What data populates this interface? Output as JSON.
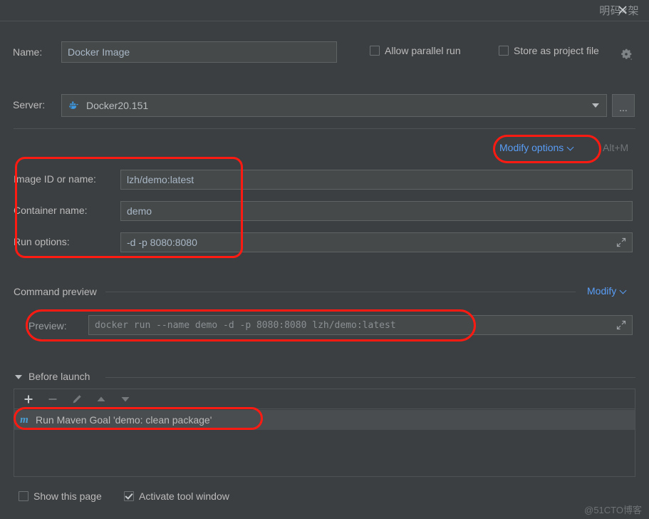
{
  "titlebar": {
    "watermark": "明码×架",
    "close_icon": "close-icon"
  },
  "name_row": {
    "label": "Name:",
    "value": "Docker Image",
    "allow_parallel_run": {
      "label": "Allow parallel run",
      "checked": false
    },
    "store_as_project_file": {
      "label": "Store as project file",
      "checked": false
    },
    "gear_icon": "gear-icon"
  },
  "server_row": {
    "label": "Server:",
    "value": "Docker20.151",
    "icon": "docker-whale-icon",
    "browse_label": "...",
    "dropdown_icon": "chevron-down-icon"
  },
  "modify_options": {
    "label": "Modify options",
    "chevron_icon": "chevron-down-icon",
    "shortcut": "Alt+M"
  },
  "params": [
    {
      "label": "Image ID or name:",
      "value": "lzh/demo:latest",
      "expand": false
    },
    {
      "label": "Container name:",
      "value": "demo",
      "expand": false
    },
    {
      "label": "Run options:",
      "value": "-d -p 8080:8080",
      "expand": true
    }
  ],
  "command_preview": {
    "title": "Command preview",
    "modify_label": "Modify",
    "modify_chevron_icon": "chevron-down-icon",
    "preview_label": "Preview:",
    "preview_value": "docker run --name demo -d -p 8080:8080 lzh/demo:latest",
    "expand_icon": "expand-icon"
  },
  "before_launch": {
    "title": "Before launch",
    "collapse_icon": "triangle-down-icon",
    "toolbar": [
      {
        "name": "add-button",
        "icon": "plus-icon",
        "enabled": true
      },
      {
        "name": "remove-button",
        "icon": "minus-icon",
        "enabled": false
      },
      {
        "name": "edit-button",
        "icon": "pencil-icon",
        "enabled": false
      },
      {
        "name": "move-up-button",
        "icon": "arrow-up-icon",
        "enabled": false
      },
      {
        "name": "move-down-button",
        "icon": "arrow-down-icon",
        "enabled": false
      }
    ],
    "items": [
      {
        "icon": "maven-icon",
        "icon_glyph": "m",
        "label": "Run Maven Goal 'demo: clean package'"
      }
    ]
  },
  "bottom": {
    "show_this_page": {
      "label": "Show this page",
      "checked": false
    },
    "activate_tool_window": {
      "label": "Activate tool window",
      "checked": true
    }
  },
  "footer_watermark": "@51CTO博客",
  "colors": {
    "background": "#3c3f41",
    "field_background": "#45494a",
    "field_border": "#5e6364",
    "text": "#bbbbbb",
    "link": "#589df6",
    "annotation": "#ff1a12",
    "maven_icon": "#4a9fd4"
  }
}
